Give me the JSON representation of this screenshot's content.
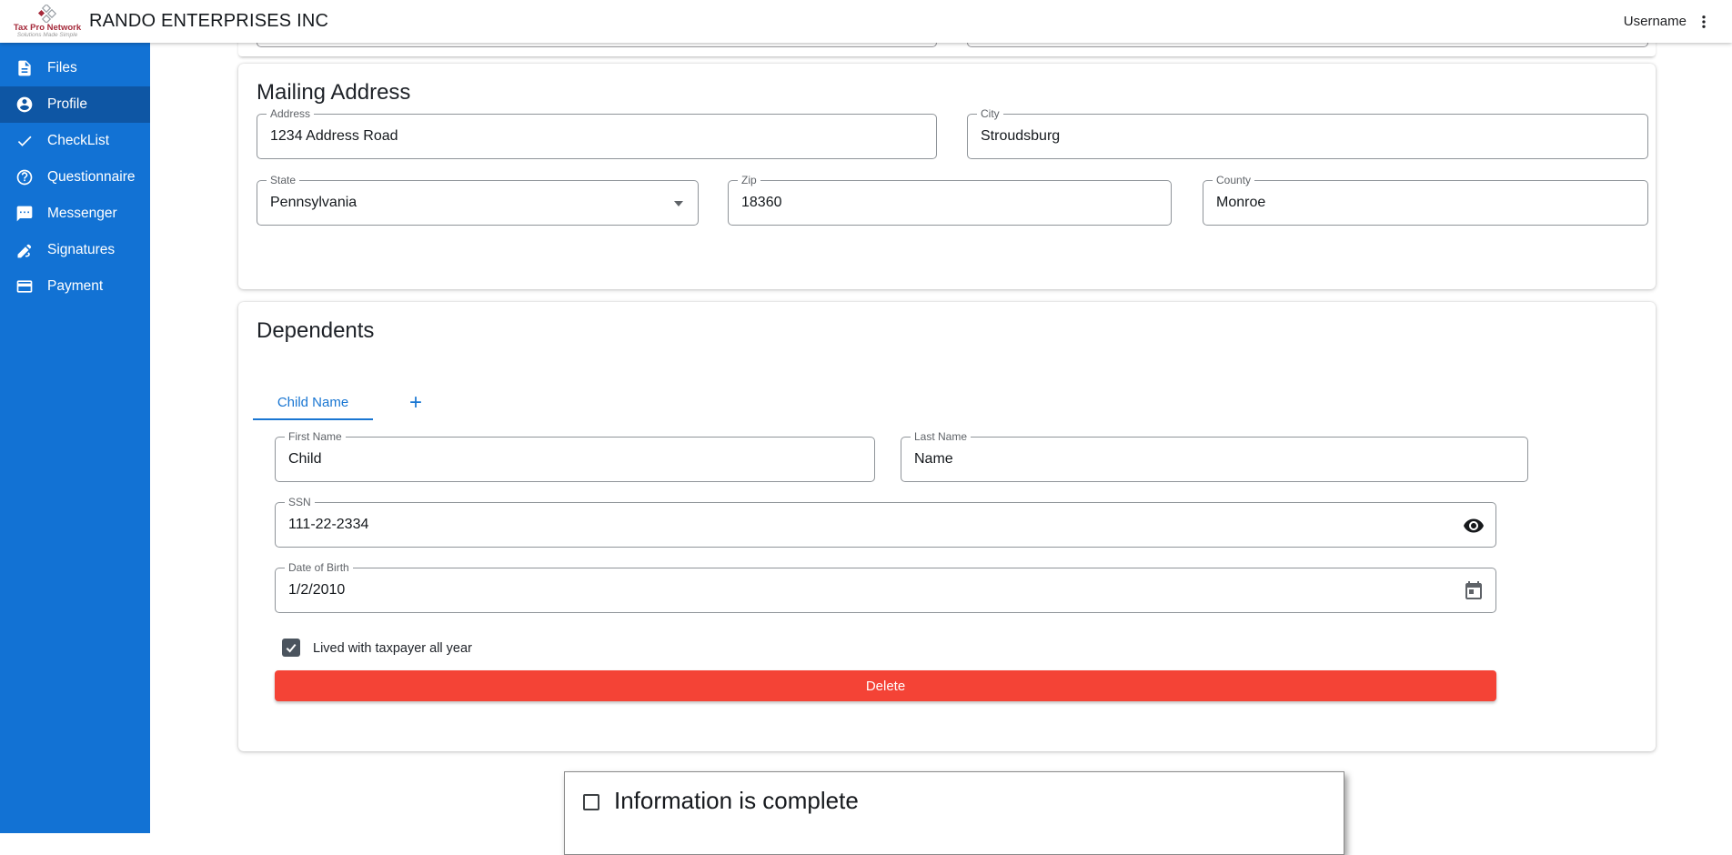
{
  "header": {
    "company_title": "RANDO ENTERPRISES INC",
    "username": "Username",
    "logo": {
      "name": "Tax Pro Network",
      "tagline": "Solutions Made Simple"
    }
  },
  "sidebar": {
    "items": [
      {
        "label": "Files",
        "icon": "file-icon",
        "active": false
      },
      {
        "label": "Profile",
        "icon": "person-icon",
        "active": true
      },
      {
        "label": "CheckList",
        "icon": "check-icon",
        "active": false
      },
      {
        "label": "Questionnaire",
        "icon": "help-icon",
        "active": false
      },
      {
        "label": "Messenger",
        "icon": "chat-icon",
        "active": false
      },
      {
        "label": "Signatures",
        "icon": "signature-pen-icon",
        "active": false
      },
      {
        "label": "Payment",
        "icon": "credit-card-icon",
        "active": false
      }
    ]
  },
  "mailing_address": {
    "title": "Mailing Address",
    "fields": {
      "address": {
        "label": "Address",
        "value": "1234 Address Road"
      },
      "city": {
        "label": "City",
        "value": "Stroudsburg"
      },
      "state": {
        "label": "State",
        "value": "Pennsylvania"
      },
      "zip": {
        "label": "Zip",
        "value": "18360"
      },
      "county": {
        "label": "County",
        "value": "Monroe"
      }
    }
  },
  "dependents": {
    "title": "Dependents",
    "tabs": [
      {
        "label": "Child Name",
        "active": true
      }
    ],
    "add_tab_label": "+",
    "fields": {
      "first_name": {
        "label": "First Name",
        "value": "Child"
      },
      "last_name": {
        "label": "Last Name",
        "value": "Name"
      },
      "ssn": {
        "label": "SSN",
        "value": "111-22-2334"
      },
      "dob": {
        "label": "Date of Birth",
        "value": "1/2/2010"
      }
    },
    "lived_checkbox": {
      "label": "Lived with taxpayer all year",
      "checked": true
    },
    "delete_button": "Delete"
  },
  "footer": {
    "complete_checkbox": {
      "label": "Information is complete",
      "checked": false
    }
  },
  "colors": {
    "sidebar_blue": "#1272d4",
    "sidebar_active_blue": "#0e56a4",
    "accent_blue": "#1976d2",
    "delete_red": "#f44336",
    "brand_red": "#a5293a"
  }
}
